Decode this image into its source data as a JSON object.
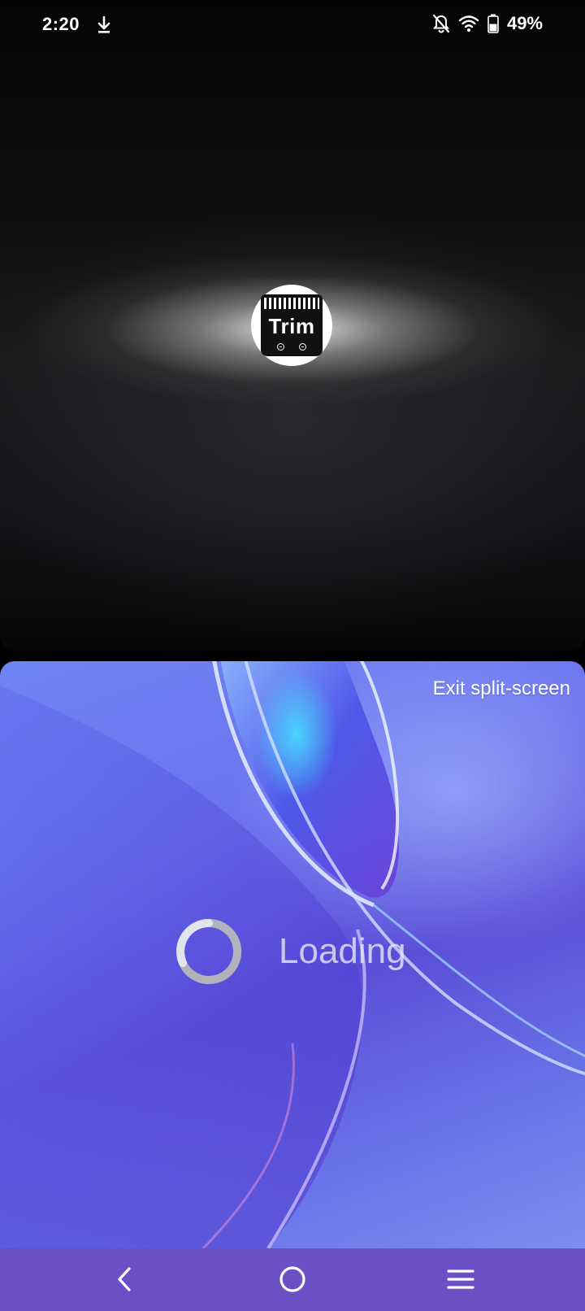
{
  "status_bar": {
    "time": "2:20",
    "battery_percent": "49%",
    "icons": [
      "download-icon",
      "notifications-off-icon",
      "wifi-icon",
      "battery-icon"
    ]
  },
  "top_app": {
    "logo_text": "Trim",
    "logo_icon": "clipper-blade-icon"
  },
  "bottom_app": {
    "exit_label": "Exit split-screen",
    "loading_label": "Loading"
  },
  "nav_bar": {
    "icons": [
      "back-icon",
      "home-icon",
      "recents-menu-icon"
    ],
    "color": "#6a4fc5"
  }
}
